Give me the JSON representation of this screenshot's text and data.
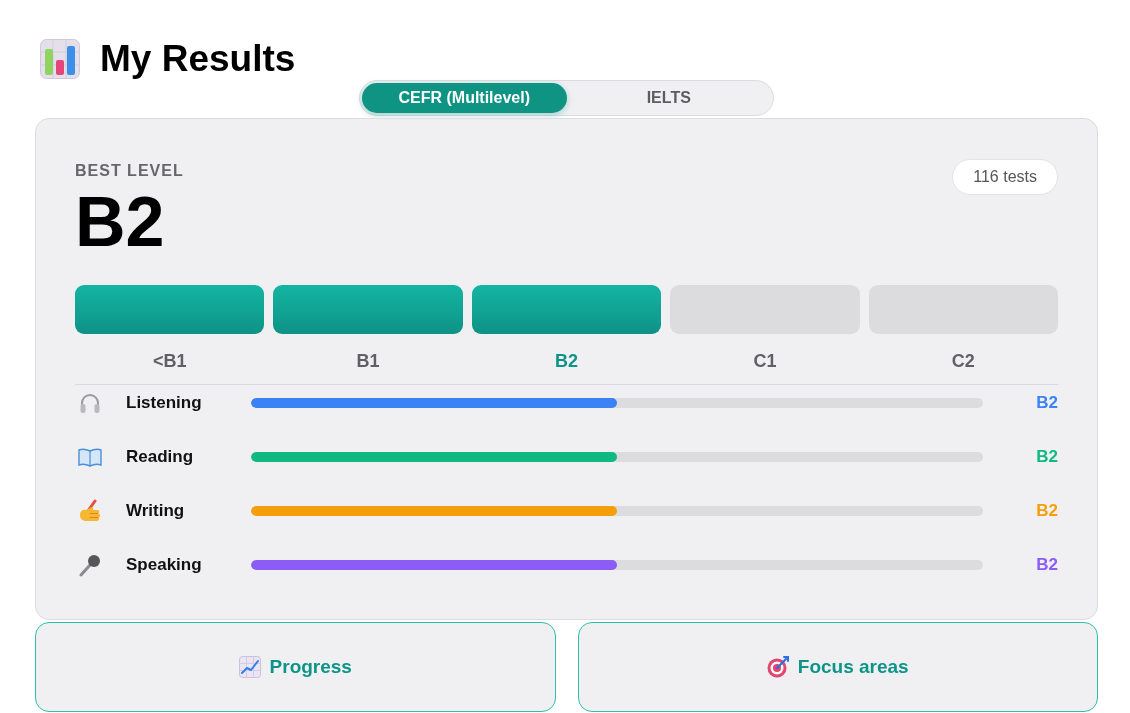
{
  "header": {
    "title": "My Results"
  },
  "scale_tabs": [
    {
      "label": "CEFR (Multilevel)",
      "selected": true
    },
    {
      "label": "IELTS",
      "selected": false
    }
  ],
  "summary": {
    "label": "BEST LEVEL",
    "level": "B2",
    "test_count": "116 tests",
    "scale": [
      {
        "label": "<B1",
        "reached": true,
        "current": false
      },
      {
        "label": "B1",
        "reached": true,
        "current": false
      },
      {
        "label": "B2",
        "reached": true,
        "current": true
      },
      {
        "label": "C1",
        "reached": false,
        "current": false
      },
      {
        "label": "C2",
        "reached": false,
        "current": false
      }
    ],
    "skills": [
      {
        "kind": "listening",
        "name": "Listening",
        "level": 0.5,
        "value": "B2",
        "color": "#3b82f6"
      },
      {
        "kind": "reading",
        "name": "Reading",
        "level": 0.5,
        "value": "B2",
        "color": "#10b981"
      },
      {
        "kind": "writing",
        "name": "Writing",
        "level": 0.5,
        "value": "B2",
        "color": "#f59e0b"
      },
      {
        "kind": "speaking",
        "name": "Speaking",
        "level": 0.5,
        "value": "B2",
        "color": "#8b5cf6"
      }
    ]
  },
  "actions": [
    {
      "kind": "progress",
      "label": "Progress"
    },
    {
      "kind": "focus",
      "label": "Focus areas"
    }
  ]
}
